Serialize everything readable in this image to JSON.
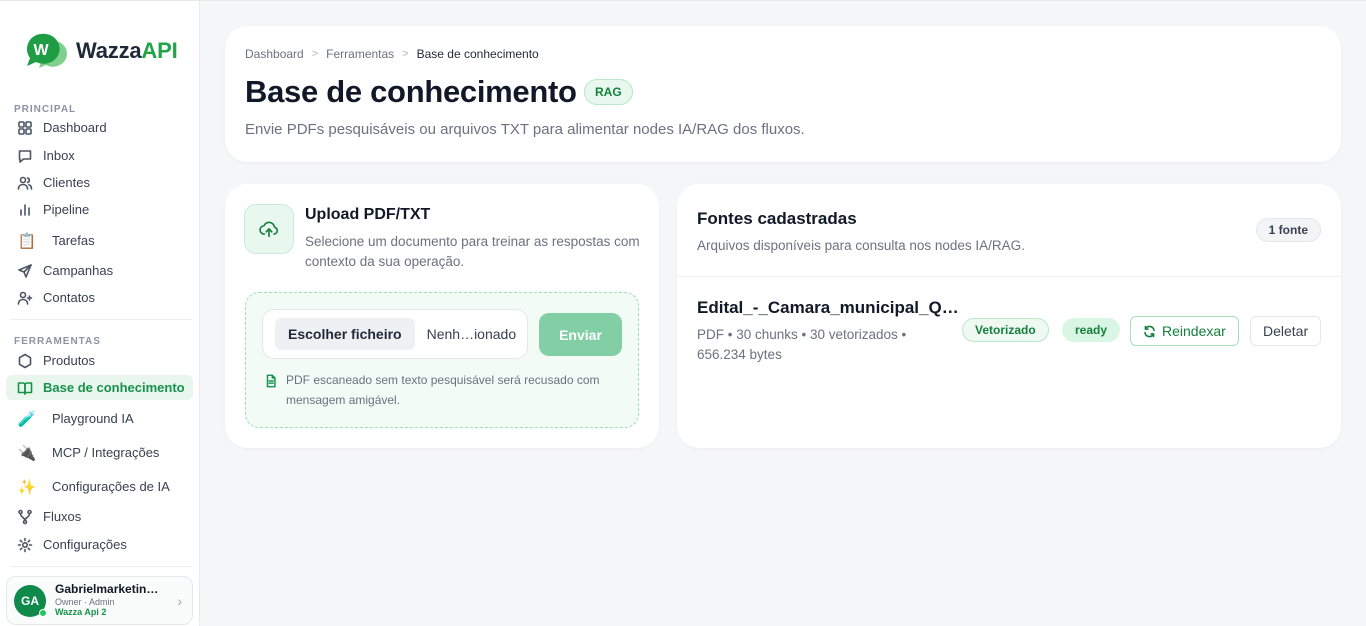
{
  "app": {
    "brand_main": "Wazza",
    "brand_accent": "API"
  },
  "sidebar": {
    "section_principal": "PRINCIPAL",
    "section_ferramentas": "FERRAMENTAS",
    "items": [
      {
        "label": "Dashboard",
        "icon": "grid-icon"
      },
      {
        "label": "Inbox",
        "icon": "message-icon"
      },
      {
        "label": "Clientes",
        "icon": "users-icon"
      },
      {
        "label": "Pipeline",
        "icon": "bar-chart-icon"
      },
      {
        "label": "Tarefas",
        "icon": "clipboard-icon"
      },
      {
        "label": "Campanhas",
        "icon": "send-icon"
      },
      {
        "label": "Contatos",
        "icon": "user-plus-icon"
      },
      {
        "label": "Produtos",
        "icon": "hexagon-icon"
      },
      {
        "label": "Base de conhecimento",
        "icon": "book-icon",
        "active": true
      },
      {
        "label": "Playground IA",
        "icon": "test-tube-icon"
      },
      {
        "label": "MCP / Integrações",
        "icon": "plug-icon"
      },
      {
        "label": "Configurações de IA",
        "icon": "sparkles-icon"
      },
      {
        "label": "Fluxos",
        "icon": "flow-icon"
      },
      {
        "label": "Configurações",
        "icon": "gear-icon"
      }
    ],
    "user": {
      "initials": "GA",
      "name": "Gabrielmarketin…",
      "role": "Owner · Admin",
      "org": "Wazza Api 2"
    }
  },
  "header": {
    "breadcrumb": [
      "Dashboard",
      "Ferramentas",
      "Base de conhecimento"
    ],
    "title": "Base de conhecimento",
    "badge": "RAG",
    "subtitle": "Envie PDFs pesquisáveis ou arquivos TXT para alimentar nodes IA/RAG dos fluxos."
  },
  "upload": {
    "title": "Upload PDF/TXT",
    "description": "Selecione um documento para treinar as respostas com contexto da sua operação.",
    "choose_label": "Escolher ficheiro",
    "file_status": "Nenh…ionado",
    "send_label": "Enviar",
    "hint": "PDF escaneado sem texto pesquisável será recusado com mensagem amigável."
  },
  "sources": {
    "title": "Fontes cadastradas",
    "subtitle": "Arquivos disponíveis para consulta nos nodes IA/RAG.",
    "count": "1 fonte",
    "items": [
      {
        "name": "Edital_-_Camara_municipal_Q…",
        "meta": "PDF • 30 chunks • 30 vetorizados • 656.234 bytes",
        "status_vector": "Vetorizado",
        "status_ready": "ready",
        "reindex_label": "Reindexar",
        "delete_label": "Deletar"
      }
    ]
  },
  "colors": {
    "accent": "#16924a",
    "accent_light": "#e9f8ef",
    "send_button": "#82cfa6"
  }
}
